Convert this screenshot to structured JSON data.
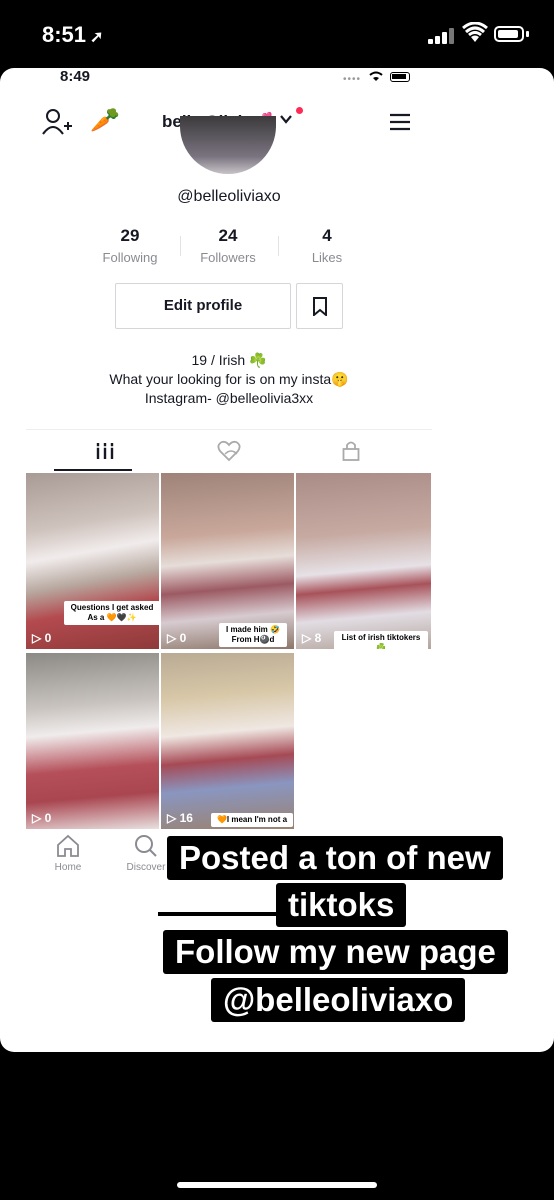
{
  "outer_status": {
    "time": "8:51"
  },
  "inner_status": {
    "time": "8:49",
    "dots": "••••"
  },
  "header": {
    "name": "belle Olivia💕"
  },
  "profile": {
    "username": "@belleoliviaxo",
    "stats": [
      {
        "num": "29",
        "label": "Following"
      },
      {
        "num": "24",
        "label": "Followers"
      },
      {
        "num": "4",
        "label": "Likes"
      }
    ],
    "edit_label": "Edit profile",
    "bio": [
      "19 / Irish ☘️",
      "What your looking for is on my insta🤫",
      "Instagram- @belleolivia3xx"
    ]
  },
  "videos": [
    {
      "plays": "0",
      "caption": "Questions I get asked As a 🧡🖤✨"
    },
    {
      "plays": "0",
      "caption": "I made him 🤣 From H🎱d"
    },
    {
      "plays": "8",
      "caption": "List of irish tiktokers☘️"
    },
    {
      "plays": "0",
      "caption": ""
    },
    {
      "plays": "16",
      "caption": "🧡I mean I'm not a"
    }
  ],
  "tabbar": {
    "home": "Home",
    "discover": "Discover"
  },
  "overlay": {
    "line1": "Posted a ton of new",
    "line2": "tiktoks",
    "line3": "Follow my new page",
    "line4": "@belleoliviaxo"
  },
  "colors": {
    "accent": "#fe2c55",
    "text": "#161823",
    "muted": "#8a8b91"
  }
}
